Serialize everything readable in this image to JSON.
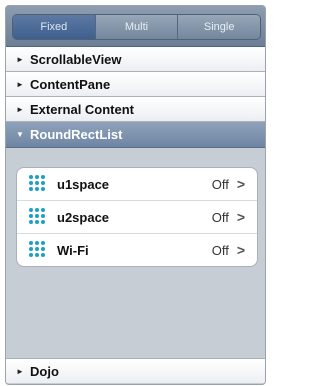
{
  "tabs": [
    {
      "label": "Fixed",
      "active": true
    },
    {
      "label": "Multi",
      "active": false
    },
    {
      "label": "Single",
      "active": false
    }
  ],
  "accordion": [
    {
      "title": "ScrollableView",
      "open": false,
      "indicator": "►"
    },
    {
      "title": "ContentPane",
      "open": false,
      "indicator": "►"
    },
    {
      "title": "External Content",
      "open": false,
      "indicator": "►"
    },
    {
      "title": "RoundRectList",
      "open": true,
      "indicator": "▼"
    },
    {
      "title": "Dojo",
      "open": false,
      "indicator": "►"
    }
  ],
  "list": [
    {
      "label": "u1space",
      "value": "Off",
      "icon": "grid-dots-icon"
    },
    {
      "label": "u2space",
      "value": "Off",
      "icon": "grid-dots-icon"
    },
    {
      "label": "Wi-Fi",
      "value": "Off",
      "icon": "grid-dots-icon"
    }
  ],
  "chevron": ">",
  "colors": {
    "accent": "#3f5f8e",
    "icon": "#1ba1c9",
    "open_header": "#6e85a3"
  }
}
